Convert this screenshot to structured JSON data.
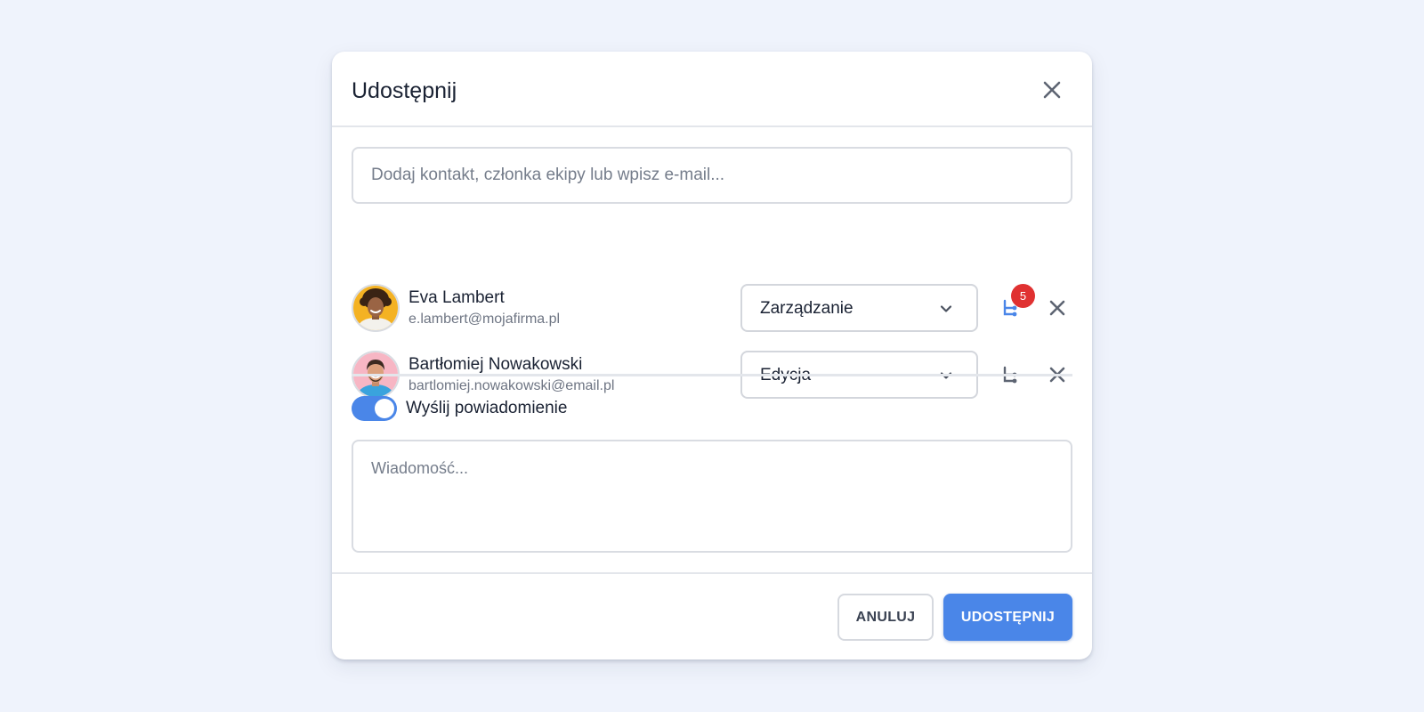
{
  "dialog": {
    "title": "Udostępnij"
  },
  "search": {
    "placeholder": "Dodaj kontakt, członka ekipy lub wpisz e-mail..."
  },
  "people": [
    {
      "name": "Eva Lambert",
      "email": "e.lambert@mojafirma.pl",
      "role": "Zarządzanie",
      "badge": "5"
    },
    {
      "name": "Bartłomiej Nowakowski",
      "email": "bartlomiej.nowakowski@email.pl",
      "role": "Edycja"
    }
  ],
  "notify": {
    "label": "Wyślij powiadomienie",
    "enabled": true
  },
  "message": {
    "placeholder": "Wiadomość..."
  },
  "footer": {
    "cancel_label": "ANULUJ",
    "share_label": "UDOSTĘPNIJ"
  },
  "colors": {
    "accent": "#4a86e8",
    "badge": "#e03131",
    "background": "#eff3fc"
  },
  "icons": {
    "close": "close-icon",
    "chevron": "chevron-down-icon",
    "hierarchy": "hierarchy-icon",
    "remove": "remove-icon"
  }
}
